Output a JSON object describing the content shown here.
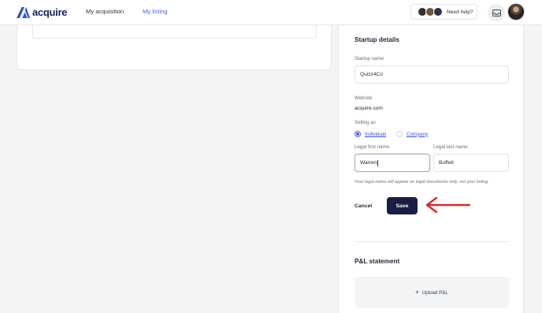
{
  "brand": {
    "name": "acquire",
    "color": "#3b4fd6"
  },
  "nav": {
    "items": [
      {
        "label": "My acquisition",
        "active": false
      },
      {
        "label": "My listing",
        "active": true
      }
    ],
    "help_label": "Need help?",
    "inbox_icon": "inbox-icon"
  },
  "startup_details": {
    "title": "Startup details",
    "startup_name": {
      "label": "Startup name",
      "value": "Quizz4Co"
    },
    "website": {
      "label": "Website",
      "value": "acquire.com"
    },
    "selling_as": {
      "label": "Selling as",
      "options": [
        {
          "label": "Individual",
          "selected": true
        },
        {
          "label": "Company",
          "selected": false
        }
      ]
    },
    "legal_first_name": {
      "label": "Legal first name",
      "value": "Warren"
    },
    "legal_last_name": {
      "label": "Legal last name",
      "value": "Buffett"
    },
    "hint": "Your legal name will appear on legal documents only, not your listing.",
    "cancel_label": "Cancel",
    "save_label": "Save"
  },
  "pl_statement": {
    "title": "P&L statement",
    "upload_label": "Upload P&L"
  },
  "colors": {
    "accent": "#4d5ee8",
    "save_button": "#1c1d44",
    "annotation_arrow": "#e0252d"
  }
}
